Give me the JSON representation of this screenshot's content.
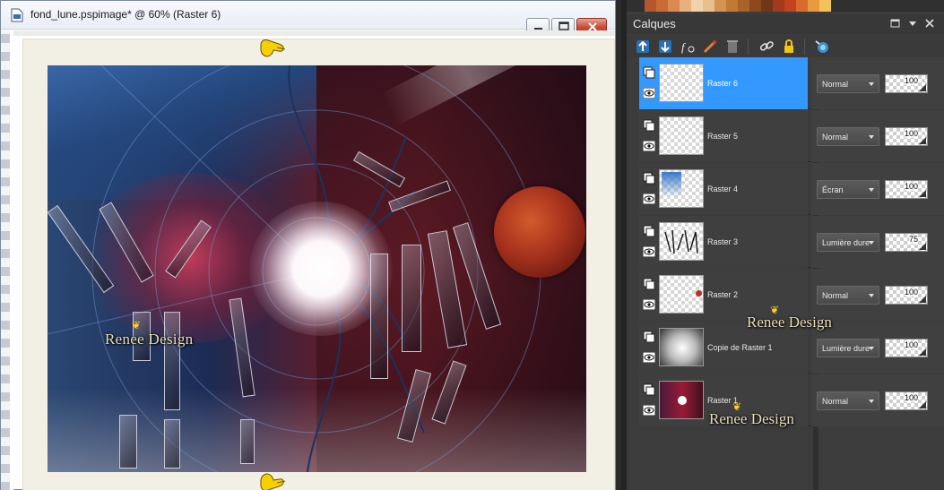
{
  "image_window": {
    "title": "fond_lune.pspimage* @  60% (Raster 6)",
    "art": {
      "watermark": "Renee Design"
    }
  },
  "layers_panel": {
    "title": "Calques",
    "palette_colors": [
      "#b3582a",
      "#c96b34",
      "#d98a4f",
      "#e8b07c",
      "#f3d1ad",
      "#e9bf8d",
      "#d39452",
      "#c07a36",
      "#a8622a",
      "#8b4a1e",
      "#6f3716",
      "#a03c1c",
      "#c4431f",
      "#d86b2a",
      "#e99a3e",
      "#f5c25a"
    ],
    "layers": [
      {
        "name": "Raster 6",
        "blend": "Normal",
        "opacity": "100",
        "selected": true,
        "thumb": "empty"
      },
      {
        "name": "Raster 5",
        "blend": "Normal",
        "opacity": "100",
        "selected": false,
        "thumb": "empty"
      },
      {
        "name": "Raster 4",
        "blend": "Écran",
        "opacity": "100",
        "selected": false,
        "thumb": "blue"
      },
      {
        "name": "Raster 3",
        "blend": "Lumière dure",
        "opacity": "75",
        "selected": false,
        "thumb": "sketch"
      },
      {
        "name": "Raster 2",
        "blend": "Normal",
        "opacity": "100",
        "selected": false,
        "thumb": "dot"
      },
      {
        "name": "Copie de Raster 1",
        "blend": "Lumière dure",
        "opacity": "100",
        "selected": false,
        "thumb": "gray"
      },
      {
        "name": "Raster 1",
        "blend": "Normal",
        "opacity": "100",
        "selected": false,
        "thumb": "red"
      }
    ],
    "watermark": "Renee Design"
  }
}
